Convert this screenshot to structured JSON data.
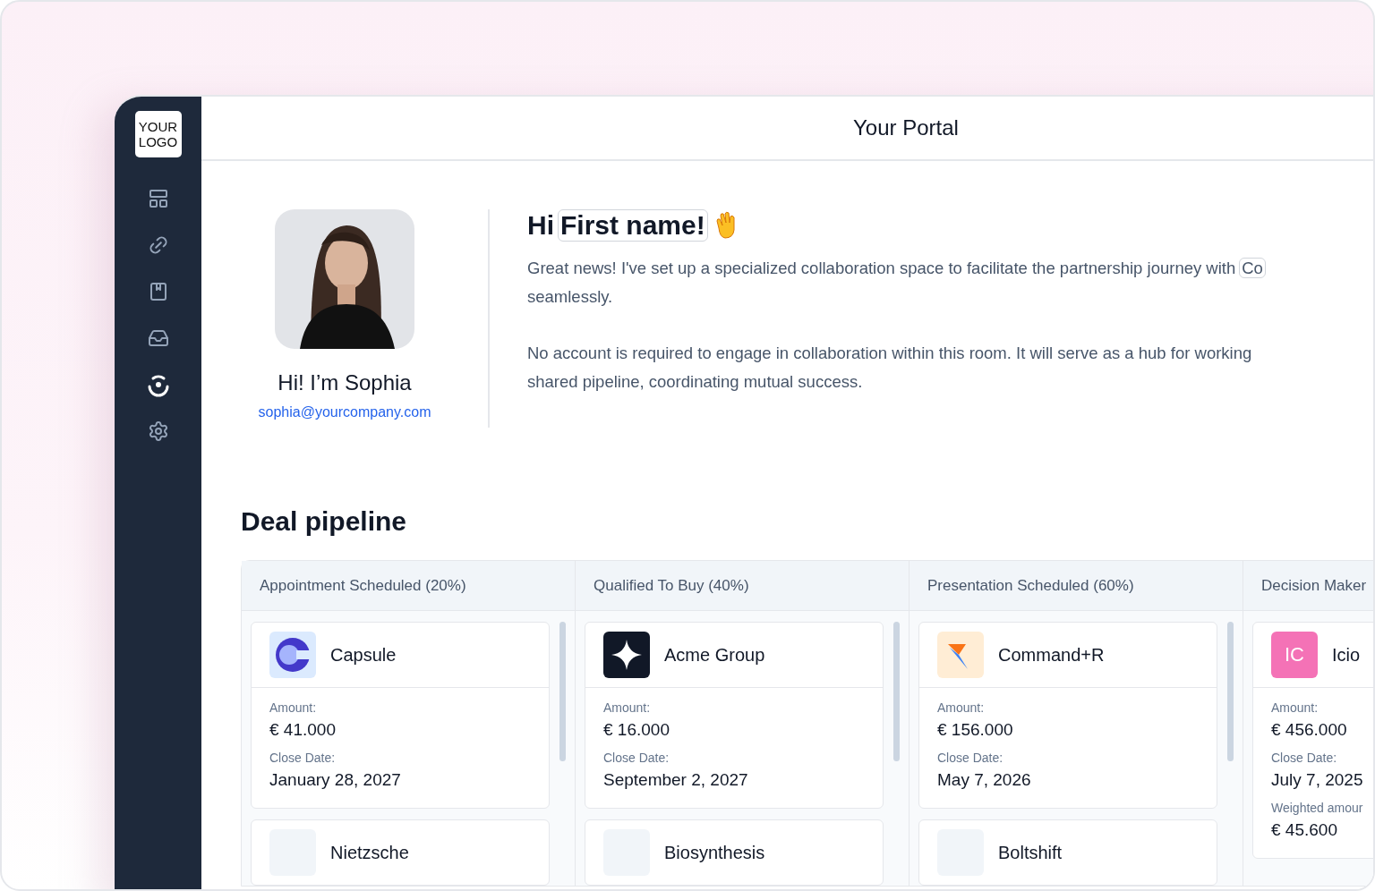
{
  "logo": "YOUR\nLOGO",
  "sidebar": {
    "items": [
      {
        "selected": false
      },
      {
        "selected": false
      },
      {
        "selected": false
      },
      {
        "selected": false
      },
      {
        "selected": true
      },
      {
        "selected": false
      }
    ]
  },
  "header": {
    "title": "Your Portal"
  },
  "profile": {
    "name": "Hi! I’m Sophia",
    "email": "sophia@yourcompany.com"
  },
  "greeting": {
    "prefix": "Hi",
    "name": "First name!"
  },
  "paragraphs": [
    {
      "lines": [
        "Great news! I've set up a specialized collaboration space to facilitate the partnership journey with"
      ],
      "chip": "Co",
      "rest": "seamlessly."
    },
    {
      "lines": [
        "No account is required to engage in collaboration within this room. It will serve as a hub for working"
      ],
      "rest": "shared pipeline, coordinating mutual success."
    }
  ],
  "pipeline": {
    "title": "Deal pipeline",
    "columns": [
      {
        "title": "Appointment Scheduled (20%)",
        "cards": [
          {
            "name": "Capsule",
            "logo": {
              "kind": "capsule"
            },
            "fields": [
              {
                "label": "Amount:",
                "value": "€ 41.000"
              },
              {
                "label": "Close Date:",
                "value": "January 28, 2027"
              }
            ]
          },
          {
            "name": "Nietzsche",
            "logo": {
              "kind": "blank"
            }
          }
        ]
      },
      {
        "title": "Qualified To Buy (40%)",
        "cards": [
          {
            "name": "Acme Group",
            "logo": {
              "kind": "star"
            },
            "fields": [
              {
                "label": "Amount:",
                "value": "€ 16.000"
              },
              {
                "label": "Close Date:",
                "value": "September 2, 2027"
              }
            ]
          },
          {
            "name": "Biosynthesis",
            "logo": {
              "kind": "blank"
            }
          }
        ]
      },
      {
        "title": "Presentation Scheduled (60%)",
        "cards": [
          {
            "name": "Command+R",
            "logo": {
              "kind": "command"
            },
            "fields": [
              {
                "label": "Amount:",
                "value": "€ 156.000"
              },
              {
                "label": "Close Date:",
                "value": "May 7, 2026"
              }
            ]
          },
          {
            "name": "Boltshift",
            "logo": {
              "kind": "blank"
            }
          }
        ]
      },
      {
        "title": "Decision Maker",
        "cards": [
          {
            "name": "Icio",
            "logo": {
              "kind": "initials",
              "text": "IC",
              "color": "#f472b6"
            },
            "fields": [
              {
                "label": "Amount:",
                "value": "€ 456.000"
              },
              {
                "label": "Close Date:",
                "value": "July 7, 2025"
              },
              {
                "label": "Weighted amour",
                "value": "€ 45.600"
              }
            ]
          }
        ]
      }
    ]
  }
}
